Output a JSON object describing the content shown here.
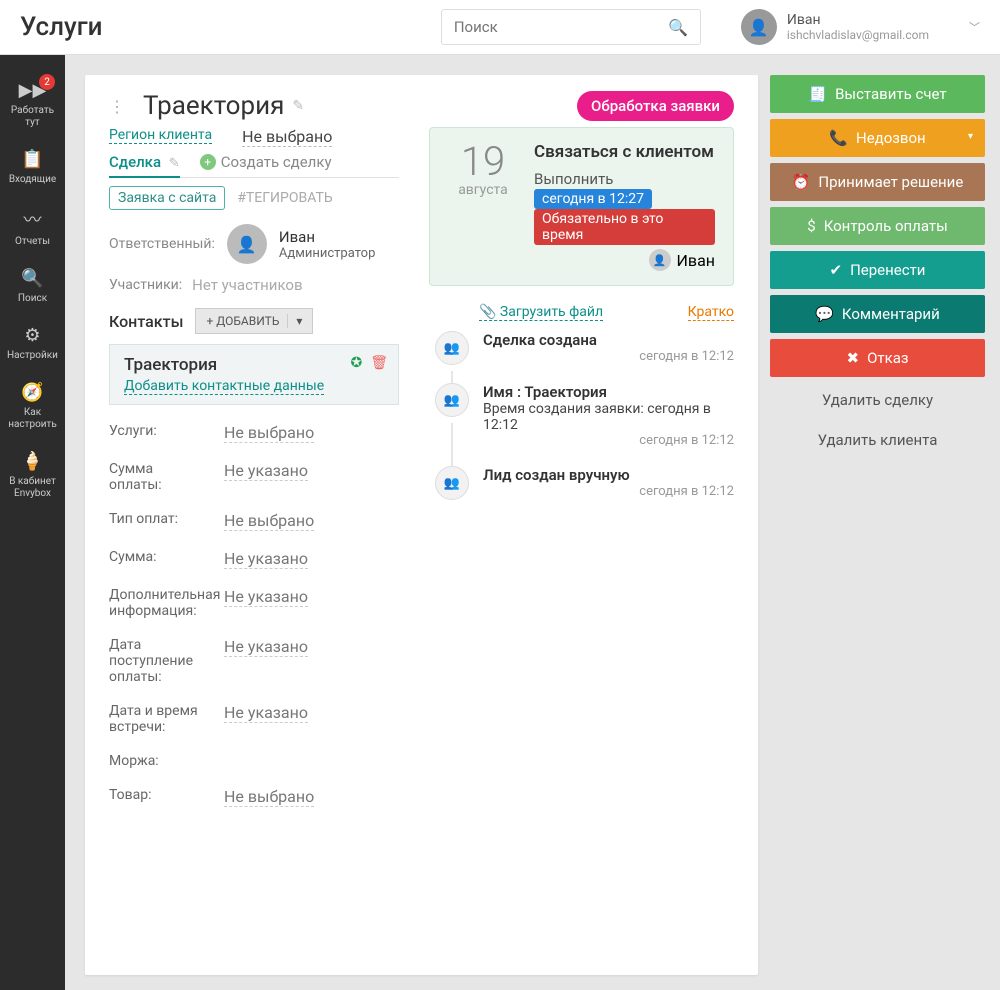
{
  "header": {
    "title": "Услуги",
    "search_placeholder": "Поиск",
    "user_name": "Иван",
    "user_email": "ishchvladislav@gmail.com"
  },
  "nav": [
    {
      "label": "Работать тут",
      "badge": "2",
      "icon": "▶▶"
    },
    {
      "label": "Входящие",
      "icon": "📋"
    },
    {
      "label": "Отчеты",
      "icon": "〰"
    },
    {
      "label": "Поиск",
      "icon": "🔍"
    },
    {
      "label": "Настройки",
      "icon": "⚙"
    },
    {
      "label": "Как настроить",
      "icon": "🧭"
    },
    {
      "label": "В кабинет Envybox",
      "icon": "🍦"
    }
  ],
  "deal": {
    "title": "Траектория",
    "status_badge": "Обработка заявки",
    "region_label": "Регион клиента",
    "region_value": "Не выбрано",
    "tab_deal": "Сделка",
    "tab_create": "Создать сделку",
    "chip": "Заявка с сайта",
    "tag_placeholder": "#ТЕГИРОВАТЬ",
    "responsible_label": "Ответственный:",
    "responsible_name": "Иван",
    "responsible_role": "Администратор",
    "participants_label": "Участники:",
    "participants_value": "Нет участников",
    "contacts_label": "Контакты",
    "add_btn": "+ ДОБАВИТЬ",
    "contact_name": "Траектория",
    "contact_link": "Добавить контактные данные",
    "fields": [
      {
        "label": "Услуги:",
        "value": "Не выбрано"
      },
      {
        "label": "Сумма оплаты:",
        "value": "Не указано"
      },
      {
        "label": "Тип оплат:",
        "value": "Не выбрано"
      },
      {
        "label": "Сумма:",
        "value": "Не указано"
      },
      {
        "label": "Дополнительная информация:",
        "value": "Не указано"
      },
      {
        "label": "Дата поступление оплаты:",
        "value": "Не указано"
      },
      {
        "label": "Дата и время встречи:",
        "value": "Не указано"
      },
      {
        "label": "Моржа:",
        "value": ""
      },
      {
        "label": "Товар:",
        "value": "Не выбрано"
      }
    ]
  },
  "task": {
    "day": "19",
    "month": "августа",
    "title": "Связаться с клиентом",
    "line": "Выполнить",
    "pill_blue": "сегодня в 12:27",
    "pill_red": "Обязательно в это время",
    "user": "Иван"
  },
  "timeline": {
    "upload": "Загрузить файл",
    "brief": "Кратко",
    "items": [
      {
        "title": "Сделка создана",
        "sub": "",
        "time": "сегодня в 12:12"
      },
      {
        "title": "Имя : Траектория",
        "sub": "Время создания заявки: сегодня в 12:12",
        "time": "сегодня в 12:12"
      },
      {
        "title": "Лид создан вручную",
        "sub": "",
        "time": "сегодня в 12:12"
      }
    ]
  },
  "actions": {
    "invoice": "Выставить счет",
    "nocall": "Недозвон",
    "deciding": "Принимает решение",
    "payment": "Контроль оплаты",
    "postpone": "Перенести",
    "comment": "Комментарий",
    "refuse": "Отказ",
    "delete_deal": "Удалить сделку",
    "delete_client": "Удалить клиента"
  }
}
